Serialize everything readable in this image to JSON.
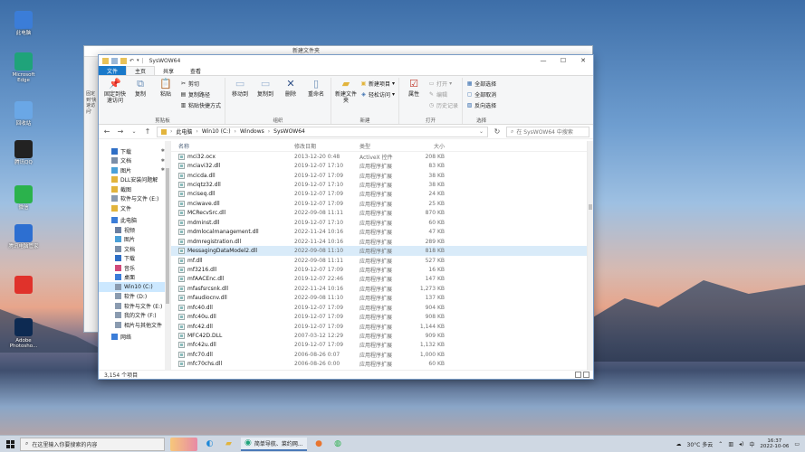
{
  "desktop_icons": [
    {
      "label": "此电脑",
      "icon": "computer-icon",
      "color": "#3b7dd8"
    },
    {
      "label": "Microsoft Edge",
      "icon": "edge-icon",
      "color": "#1fa37a"
    },
    {
      "label": "回收站",
      "icon": "recycle-bin-icon",
      "color": "#6aa7e6"
    },
    {
      "label": "腾讯QQ",
      "icon": "qq-icon",
      "color": "#222222"
    },
    {
      "label": "微信",
      "icon": "wechat-icon",
      "color": "#2bb24c"
    },
    {
      "label": "腾讯电脑管家",
      "icon": "pc-manager-icon",
      "color": "#2d6fd1"
    },
    {
      "label": "",
      "icon": "app-icon",
      "color": "#e0322b"
    },
    {
      "label": "Adobe Photosho...",
      "icon": "photoshop-icon",
      "color": "#0d2a52"
    }
  ],
  "back_window": {
    "title": "新建文件夹",
    "side_label": "固定到'快速访问'"
  },
  "window": {
    "title": "SysWOW64",
    "tabs": [
      "文件",
      "主页",
      "共享",
      "查看"
    ],
    "ribbon": {
      "clipboard": {
        "label": "剪贴板",
        "pin": "固定到快速访问",
        "copy": "复制",
        "paste": "粘贴",
        "cut": "剪切",
        "copy_path": "复制路径",
        "paste_shortcut": "粘贴快捷方式"
      },
      "organize": {
        "label": "组织",
        "move_to": "移动到",
        "copy_to": "复制到",
        "delete": "删除",
        "rename": "重命名"
      },
      "new": {
        "label": "新建",
        "new_folder": "新建文件夹",
        "new_item": "新建项目",
        "easy_access": "轻松访问"
      },
      "open": {
        "label": "打开",
        "properties": "属性",
        "open": "打开",
        "edit": "编辑",
        "history": "历史记录"
      },
      "select": {
        "label": "选择",
        "select_all": "全部选择",
        "select_none": "全部取消",
        "invert": "反向选择"
      }
    },
    "address": {
      "crumbs": [
        "此电脑",
        "Win10 (C:)",
        "Windows",
        "SysWOW64"
      ],
      "search_placeholder": "在 SysWOW64 中搜索"
    },
    "nav": [
      {
        "label": "下载",
        "icon": "download-icon",
        "pin": true,
        "sub": false
      },
      {
        "label": "文档",
        "icon": "document-icon",
        "pin": true,
        "sub": false
      },
      {
        "label": "图片",
        "icon": "picture-icon",
        "pin": true,
        "sub": false
      },
      {
        "label": "DLL安装问题解",
        "icon": "folder-icon",
        "pin": false,
        "sub": false
      },
      {
        "label": "截图",
        "icon": "folder-icon",
        "pin": false,
        "sub": false
      },
      {
        "label": "软件与文件 (E:)",
        "icon": "drive-icon",
        "pin": false,
        "sub": false
      },
      {
        "label": "文件",
        "icon": "folder-icon",
        "pin": false,
        "sub": false
      },
      {
        "label": "此电脑",
        "icon": "computer-icon",
        "pin": false,
        "sub": false
      },
      {
        "label": "视频",
        "icon": "video-icon",
        "pin": false,
        "sub": true
      },
      {
        "label": "图片",
        "icon": "picture-icon",
        "pin": false,
        "sub": true
      },
      {
        "label": "文档",
        "icon": "document-icon",
        "pin": false,
        "sub": true
      },
      {
        "label": "下载",
        "icon": "download-icon",
        "pin": false,
        "sub": true
      },
      {
        "label": "音乐",
        "icon": "music-icon",
        "pin": false,
        "sub": true
      },
      {
        "label": "桌面",
        "icon": "desktop-icon",
        "pin": false,
        "sub": true
      },
      {
        "label": "Win10 (C:)",
        "icon": "drive-icon",
        "pin": false,
        "sub": true,
        "selected": true
      },
      {
        "label": "软件 (D:)",
        "icon": "drive-icon",
        "pin": false,
        "sub": true
      },
      {
        "label": "软件与文件 (E:)",
        "icon": "drive-icon",
        "pin": false,
        "sub": true
      },
      {
        "label": "我的文件 (F:)",
        "icon": "drive-icon",
        "pin": false,
        "sub": true
      },
      {
        "label": "相片与其他文件",
        "icon": "drive-icon",
        "pin": false,
        "sub": true
      },
      {
        "label": "网络",
        "icon": "network-icon",
        "pin": false,
        "sub": false
      }
    ],
    "columns": [
      "名称",
      "修改日期",
      "类型",
      "大小"
    ],
    "files": [
      {
        "name": "mci32.ocx",
        "date": "2013-12-20 0:48",
        "type": "ActiveX 控件",
        "size": "208 KB"
      },
      {
        "name": "mciavi32.dll",
        "date": "2019-12-07 17:10",
        "type": "应用程序扩展",
        "size": "83 KB"
      },
      {
        "name": "mcicda.dll",
        "date": "2019-12-07 17:09",
        "type": "应用程序扩展",
        "size": "38 KB"
      },
      {
        "name": "mciqtz32.dll",
        "date": "2019-12-07 17:10",
        "type": "应用程序扩展",
        "size": "38 KB"
      },
      {
        "name": "mciseq.dll",
        "date": "2019-12-07 17:09",
        "type": "应用程序扩展",
        "size": "24 KB"
      },
      {
        "name": "mciwave.dll",
        "date": "2019-12-07 17:09",
        "type": "应用程序扩展",
        "size": "25 KB"
      },
      {
        "name": "MCRecvSrc.dll",
        "date": "2022-09-08 11:11",
        "type": "应用程序扩展",
        "size": "870 KB"
      },
      {
        "name": "mdminst.dll",
        "date": "2019-12-07 17:10",
        "type": "应用程序扩展",
        "size": "60 KB"
      },
      {
        "name": "mdmlocalmanagement.dll",
        "date": "2022-11-24 10:16",
        "type": "应用程序扩展",
        "size": "47 KB"
      },
      {
        "name": "mdmregistration.dll",
        "date": "2022-11-24 10:16",
        "type": "应用程序扩展",
        "size": "289 KB"
      },
      {
        "name": "MessagingDataModel2.dll",
        "date": "2022-09-08 11:10",
        "type": "应用程序扩展",
        "size": "818 KB",
        "selected": true
      },
      {
        "name": "mf.dll",
        "date": "2022-09-08 11:11",
        "type": "应用程序扩展",
        "size": "527 KB"
      },
      {
        "name": "mf3216.dll",
        "date": "2019-12-07 17:09",
        "type": "应用程序扩展",
        "size": "16 KB"
      },
      {
        "name": "mfAACEnc.dll",
        "date": "2019-12-07 22:46",
        "type": "应用程序扩展",
        "size": "147 KB"
      },
      {
        "name": "mfasfsrcsnk.dll",
        "date": "2022-11-24 10:16",
        "type": "应用程序扩展",
        "size": "1,273 KB"
      },
      {
        "name": "mfaudiocnv.dll",
        "date": "2022-09-08 11:10",
        "type": "应用程序扩展",
        "size": "137 KB"
      },
      {
        "name": "mfc40.dll",
        "date": "2019-12-07 17:09",
        "type": "应用程序扩展",
        "size": "904 KB"
      },
      {
        "name": "mfc40u.dll",
        "date": "2019-12-07 17:09",
        "type": "应用程序扩展",
        "size": "908 KB"
      },
      {
        "name": "mfc42.dll",
        "date": "2019-12-07 17:09",
        "type": "应用程序扩展",
        "size": "1,144 KB"
      },
      {
        "name": "MFC42D.DLL",
        "date": "2007-03-12 12:29",
        "type": "应用程序扩展",
        "size": "909 KB"
      },
      {
        "name": "mfc42u.dll",
        "date": "2019-12-07 17:09",
        "type": "应用程序扩展",
        "size": "1,132 KB"
      },
      {
        "name": "mfc70.dll",
        "date": "2006-08-26 0:07",
        "type": "应用程序扩展",
        "size": "1,000 KB"
      },
      {
        "name": "mfc70chs.dll",
        "date": "2006-08-26 0:00",
        "type": "应用程序扩展",
        "size": "60 KB"
      }
    ],
    "status": "3,154 个项目"
  },
  "taskbar": {
    "search_placeholder": "在这里输入你要搜索的内容",
    "task_label": "简单导航、菜约网...",
    "weather": "30°C 多云",
    "ime": "中",
    "time": "16:37",
    "date": "2022-10-06"
  }
}
